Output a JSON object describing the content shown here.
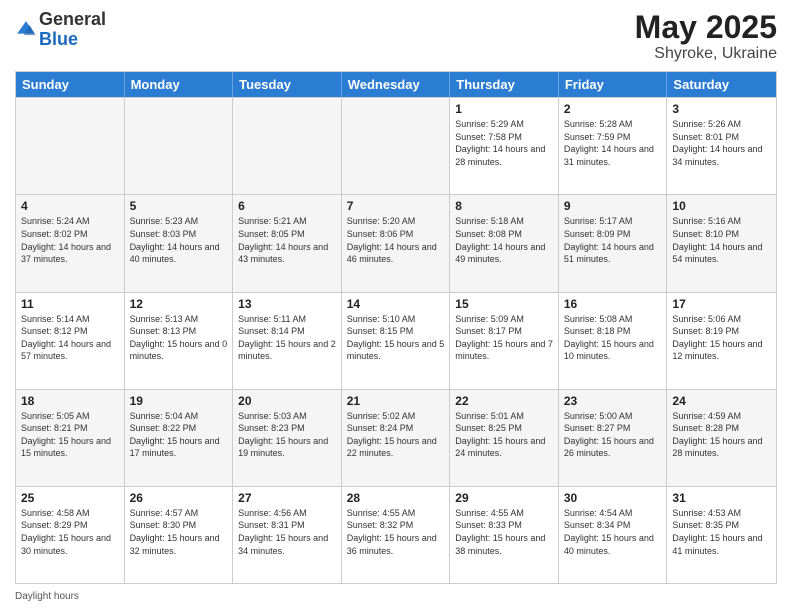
{
  "header": {
    "logo_general": "General",
    "logo_blue": "Blue",
    "title": "May 2025",
    "location": "Shyroke, Ukraine"
  },
  "days_of_week": [
    "Sunday",
    "Monday",
    "Tuesday",
    "Wednesday",
    "Thursday",
    "Friday",
    "Saturday"
  ],
  "weeks": [
    [
      {
        "day": "",
        "empty": true
      },
      {
        "day": "",
        "empty": true
      },
      {
        "day": "",
        "empty": true
      },
      {
        "day": "",
        "empty": true
      },
      {
        "day": "1",
        "sunrise": "5:29 AM",
        "sunset": "7:58 PM",
        "daylight": "14 hours and 28 minutes."
      },
      {
        "day": "2",
        "sunrise": "5:28 AM",
        "sunset": "7:59 PM",
        "daylight": "14 hours and 31 minutes."
      },
      {
        "day": "3",
        "sunrise": "5:26 AM",
        "sunset": "8:01 PM",
        "daylight": "14 hours and 34 minutes."
      }
    ],
    [
      {
        "day": "4",
        "sunrise": "5:24 AM",
        "sunset": "8:02 PM",
        "daylight": "14 hours and 37 minutes."
      },
      {
        "day": "5",
        "sunrise": "5:23 AM",
        "sunset": "8:03 PM",
        "daylight": "14 hours and 40 minutes."
      },
      {
        "day": "6",
        "sunrise": "5:21 AM",
        "sunset": "8:05 PM",
        "daylight": "14 hours and 43 minutes."
      },
      {
        "day": "7",
        "sunrise": "5:20 AM",
        "sunset": "8:06 PM",
        "daylight": "14 hours and 46 minutes."
      },
      {
        "day": "8",
        "sunrise": "5:18 AM",
        "sunset": "8:08 PM",
        "daylight": "14 hours and 49 minutes."
      },
      {
        "day": "9",
        "sunrise": "5:17 AM",
        "sunset": "8:09 PM",
        "daylight": "14 hours and 51 minutes."
      },
      {
        "day": "10",
        "sunrise": "5:16 AM",
        "sunset": "8:10 PM",
        "daylight": "14 hours and 54 minutes."
      }
    ],
    [
      {
        "day": "11",
        "sunrise": "5:14 AM",
        "sunset": "8:12 PM",
        "daylight": "14 hours and 57 minutes."
      },
      {
        "day": "12",
        "sunrise": "5:13 AM",
        "sunset": "8:13 PM",
        "daylight": "15 hours and 0 minutes."
      },
      {
        "day": "13",
        "sunrise": "5:11 AM",
        "sunset": "8:14 PM",
        "daylight": "15 hours and 2 minutes."
      },
      {
        "day": "14",
        "sunrise": "5:10 AM",
        "sunset": "8:15 PM",
        "daylight": "15 hours and 5 minutes."
      },
      {
        "day": "15",
        "sunrise": "5:09 AM",
        "sunset": "8:17 PM",
        "daylight": "15 hours and 7 minutes."
      },
      {
        "day": "16",
        "sunrise": "5:08 AM",
        "sunset": "8:18 PM",
        "daylight": "15 hours and 10 minutes."
      },
      {
        "day": "17",
        "sunrise": "5:06 AM",
        "sunset": "8:19 PM",
        "daylight": "15 hours and 12 minutes."
      }
    ],
    [
      {
        "day": "18",
        "sunrise": "5:05 AM",
        "sunset": "8:21 PM",
        "daylight": "15 hours and 15 minutes."
      },
      {
        "day": "19",
        "sunrise": "5:04 AM",
        "sunset": "8:22 PM",
        "daylight": "15 hours and 17 minutes."
      },
      {
        "day": "20",
        "sunrise": "5:03 AM",
        "sunset": "8:23 PM",
        "daylight": "15 hours and 19 minutes."
      },
      {
        "day": "21",
        "sunrise": "5:02 AM",
        "sunset": "8:24 PM",
        "daylight": "15 hours and 22 minutes."
      },
      {
        "day": "22",
        "sunrise": "5:01 AM",
        "sunset": "8:25 PM",
        "daylight": "15 hours and 24 minutes."
      },
      {
        "day": "23",
        "sunrise": "5:00 AM",
        "sunset": "8:27 PM",
        "daylight": "15 hours and 26 minutes."
      },
      {
        "day": "24",
        "sunrise": "4:59 AM",
        "sunset": "8:28 PM",
        "daylight": "15 hours and 28 minutes."
      }
    ],
    [
      {
        "day": "25",
        "sunrise": "4:58 AM",
        "sunset": "8:29 PM",
        "daylight": "15 hours and 30 minutes."
      },
      {
        "day": "26",
        "sunrise": "4:57 AM",
        "sunset": "8:30 PM",
        "daylight": "15 hours and 32 minutes."
      },
      {
        "day": "27",
        "sunrise": "4:56 AM",
        "sunset": "8:31 PM",
        "daylight": "15 hours and 34 minutes."
      },
      {
        "day": "28",
        "sunrise": "4:55 AM",
        "sunset": "8:32 PM",
        "daylight": "15 hours and 36 minutes."
      },
      {
        "day": "29",
        "sunrise": "4:55 AM",
        "sunset": "8:33 PM",
        "daylight": "15 hours and 38 minutes."
      },
      {
        "day": "30",
        "sunrise": "4:54 AM",
        "sunset": "8:34 PM",
        "daylight": "15 hours and 40 minutes."
      },
      {
        "day": "31",
        "sunrise": "4:53 AM",
        "sunset": "8:35 PM",
        "daylight": "15 hours and 41 minutes."
      }
    ]
  ],
  "footer": {
    "note": "Daylight hours"
  }
}
